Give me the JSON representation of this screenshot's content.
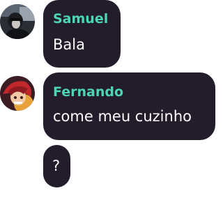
{
  "messages": [
    {
      "sender": "Samuel",
      "text": "Bala",
      "avatar_icon": "dark-figure-avatar-icon"
    },
    {
      "sender": "Fernando",
      "text": "come meu cuzinho",
      "avatar_icon": "red-anime-character-avatar-icon"
    },
    {
      "sender": "",
      "text": "?"
    }
  ],
  "colors": {
    "bubble": "#221c2b",
    "sender_name": "#4cd6b5",
    "message_text": "#ffffff",
    "background": "#ffffff"
  }
}
